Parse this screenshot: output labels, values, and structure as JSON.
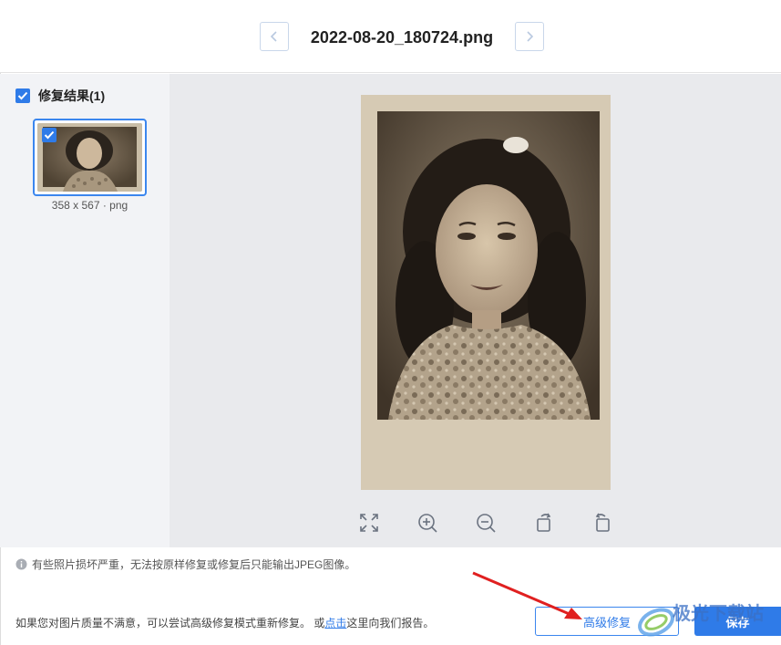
{
  "header": {
    "file_name": "2022-08-20_180724.png",
    "prev_icon": "chevron-left-icon",
    "next_icon": "chevron-right-icon"
  },
  "sidebar": {
    "result_label": "修复结果(1)",
    "result_checked": true,
    "thumbnail": {
      "checked": true,
      "meta": "358 x 567 · png"
    }
  },
  "viewer": {
    "toolbar": [
      {
        "name": "fit-screen-icon"
      },
      {
        "name": "zoom-in-icon"
      },
      {
        "name": "zoom-out-icon"
      },
      {
        "name": "rotate-left-icon"
      },
      {
        "name": "rotate-right-icon"
      }
    ]
  },
  "notice": {
    "text": "有些照片损坏严重，无法按原样修复或修复后只能输出JPEG图像。"
  },
  "footer": {
    "text_before": "如果您对图片质量不满意，可以尝试高级修复模式重新修复。 或",
    "link_text": "点击",
    "text_after": "这里向我们报告。",
    "advanced_button": "高级修复",
    "save_button": "保存"
  },
  "watermark": {
    "text": "极光下载站"
  },
  "colors": {
    "accent": "#2f7be8",
    "sidebar_bg": "#f2f3f6",
    "viewer_bg": "#e9eaed",
    "annotation_arrow": "#e02020"
  }
}
